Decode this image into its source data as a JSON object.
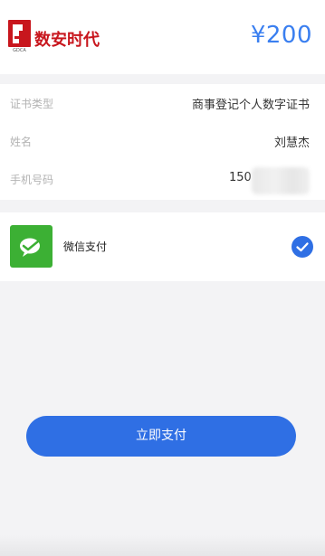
{
  "header": {
    "brand_name": "数安时代",
    "brand_subtext": "GDCA",
    "amount": "¥200"
  },
  "info": {
    "rows": [
      {
        "label": "证书类型",
        "value": "商事登记个人数字证书"
      },
      {
        "label": "姓名",
        "value": "刘慧杰"
      },
      {
        "label": "手机号码",
        "value": "150"
      }
    ]
  },
  "payment": {
    "method_label": "微信支付",
    "selected": true
  },
  "actions": {
    "pay_now_label": "立即支付"
  },
  "colors": {
    "accent": "#2f6fe4",
    "price": "#3a7ff0",
    "brand": "#c8161d",
    "wechat": "#3cb034"
  }
}
